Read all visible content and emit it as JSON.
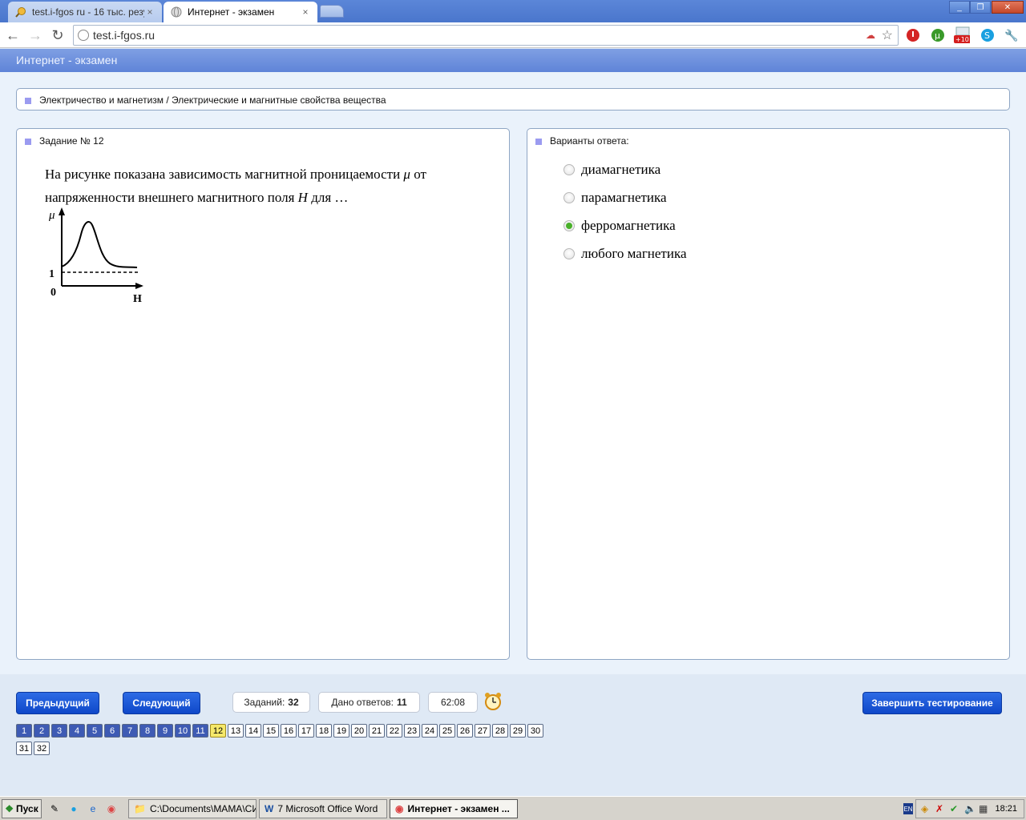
{
  "browser": {
    "tabs": [
      {
        "title": "test.i-fgos ru - 16 тыс. резул",
        "close": "×"
      },
      {
        "title": "Интернет - экзамен",
        "close": "×"
      }
    ],
    "url": "test.i-fgos.ru",
    "window_controls": [
      "_",
      "❐",
      "✕"
    ]
  },
  "app": {
    "header_title": "Интернет - экзамен",
    "breadcrumb": "Электричество и магнетизм / Электрические и магнитные свойства вещества"
  },
  "question": {
    "header": "Задание № 12",
    "text_part1": "На рисунке показана зависимость магнитной проницаемости",
    "mu": "μ",
    "text_part2": "от напряженности внешнего магнитного поля",
    "H": "H",
    "text_part3": "для …",
    "graph": {
      "y_label": "μ",
      "x_label": "H",
      "tick_one": "1",
      "origin": "0"
    }
  },
  "answers": {
    "header": "Варианты ответа:",
    "options": [
      {
        "label": "диамагнетика",
        "selected": false
      },
      {
        "label": "парамагнетика",
        "selected": false
      },
      {
        "label": "ферромагнетика",
        "selected": true
      },
      {
        "label": "любого магнетика",
        "selected": false
      }
    ]
  },
  "controls": {
    "prev_label": "Предыдущий",
    "next_label": "Следующий",
    "tasks_label": "Заданий:",
    "tasks_value": "32",
    "answered_label": "Дано ответов:",
    "answered_value": "11",
    "timer": "62:08",
    "finish_label": "Завершить тестирование"
  },
  "pager": {
    "pages": [
      "1",
      "2",
      "3",
      "4",
      "5",
      "6",
      "7",
      "8",
      "9",
      "10",
      "11",
      "12",
      "13",
      "14",
      "15",
      "16",
      "17",
      "18",
      "19",
      "20",
      "21",
      "22",
      "23",
      "24",
      "25",
      "26",
      "27",
      "28",
      "29",
      "30",
      "31",
      "32"
    ],
    "current": 12,
    "answered_count": 11
  },
  "taskbar": {
    "start_label": "Пуск",
    "items": [
      {
        "label": "C:\\Documents\\МАМА\\СИ..."
      },
      {
        "label": "7 Microsoft Office Word"
      },
      {
        "label": "Интернет - экзамен ..."
      }
    ],
    "lang": "EN",
    "clock": "18:21"
  },
  "colors": {
    "accent": "#1a55d6",
    "header": "#6f92dd",
    "selected_radio": "#49b02a",
    "current_page": "#f5e86a"
  }
}
